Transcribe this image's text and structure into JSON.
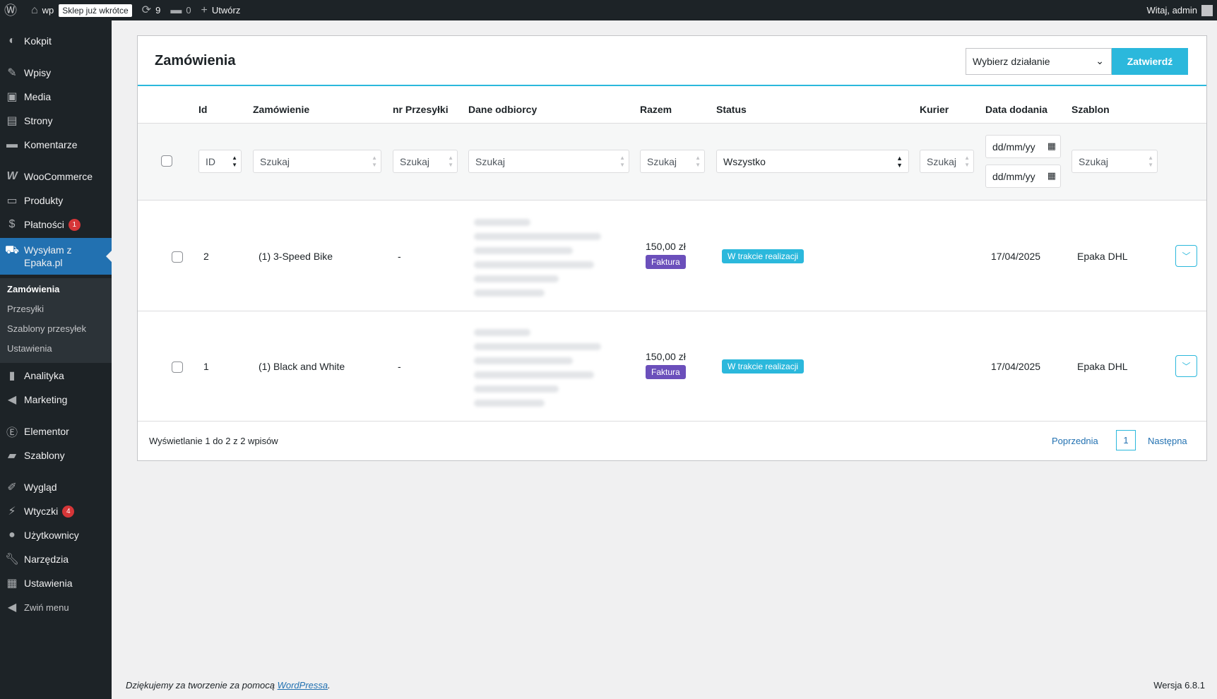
{
  "adminbar": {
    "wp_icon": "wordpress-icon",
    "site_icon": "home-icon",
    "site_name": "wp",
    "maintenance_badge": "Sklep już wkrótce",
    "updates_count": "9",
    "comments_count": "0",
    "new_label": "Utwórz",
    "greeting": "Witaj, admin"
  },
  "sidebar": {
    "items": [
      {
        "label": "Kokpit",
        "icon": "dashboard-icon"
      },
      {
        "label": "Wpisy",
        "icon": "pin-icon"
      },
      {
        "label": "Media",
        "icon": "media-icon"
      },
      {
        "label": "Strony",
        "icon": "pages-icon"
      },
      {
        "label": "Komentarze",
        "icon": "comments-icon"
      },
      {
        "label": "WooCommerce",
        "icon": "woocommerce-icon"
      },
      {
        "label": "Produkty",
        "icon": "products-icon"
      },
      {
        "label": "Płatności",
        "icon": "payments-icon",
        "badge": "1"
      },
      {
        "label": "Wysyłam z Epaka.pl",
        "icon": "car-icon"
      },
      {
        "label": "Analityka",
        "icon": "chart-icon"
      },
      {
        "label": "Marketing",
        "icon": "megaphone-icon"
      },
      {
        "label": "Elementor",
        "icon": "elementor-icon"
      },
      {
        "label": "Szablony",
        "icon": "folder-icon"
      },
      {
        "label": "Wygląd",
        "icon": "brush-icon"
      },
      {
        "label": "Wtyczki",
        "icon": "plugin-icon",
        "badge": "4"
      },
      {
        "label": "Użytkownicy",
        "icon": "user-icon"
      },
      {
        "label": "Narzędzia",
        "icon": "wrench-icon"
      },
      {
        "label": "Ustawienia",
        "icon": "settings-icon"
      },
      {
        "label": "Zwiń menu",
        "icon": "collapse-icon"
      }
    ],
    "submenu": [
      "Zamówienia",
      "Przesyłki",
      "Szablony przesyłek",
      "Ustawienia"
    ]
  },
  "main": {
    "title": "Zamówienia",
    "bulk_action": "Wybierz działanie",
    "apply": "Zatwierdź",
    "columns": [
      "Id",
      "Zamówienie",
      "nr Przesyłki",
      "Dane odbiorcy",
      "Razem",
      "Status",
      "Kurier",
      "Data dodania",
      "Szablon"
    ],
    "filters": {
      "id_placeholder": "ID",
      "search_placeholder": "Szukaj",
      "status_value": "Wszystko",
      "date_placeholder": "dd/mm/yy"
    },
    "rows": [
      {
        "id": "2",
        "order": "(1) 3-Speed Bike",
        "tracking": "-",
        "total": "150,00 zł",
        "invoice": "Faktura",
        "status": "W trakcie realizacji",
        "courier": "",
        "date": "17/04/2025",
        "template": "Epaka DHL"
      },
      {
        "id": "1",
        "order": "(1) Black and White",
        "tracking": "-",
        "total": "150,00 zł",
        "invoice": "Faktura",
        "status": "W trakcie realizacji",
        "courier": "",
        "date": "17/04/2025",
        "template": "Epaka DHL"
      }
    ],
    "entries_info": "Wyświetlanie 1 do 2 z 2 wpisów",
    "pagination": {
      "prev": "Poprzednia",
      "current": "1",
      "next": "Następna"
    }
  },
  "footer": {
    "thanks_prefix": "Dziękujemy za tworzenie za pomocą ",
    "thanks_link": "WordPressa",
    "thanks_suffix": ".",
    "version": "Wersja 6.8.1"
  }
}
